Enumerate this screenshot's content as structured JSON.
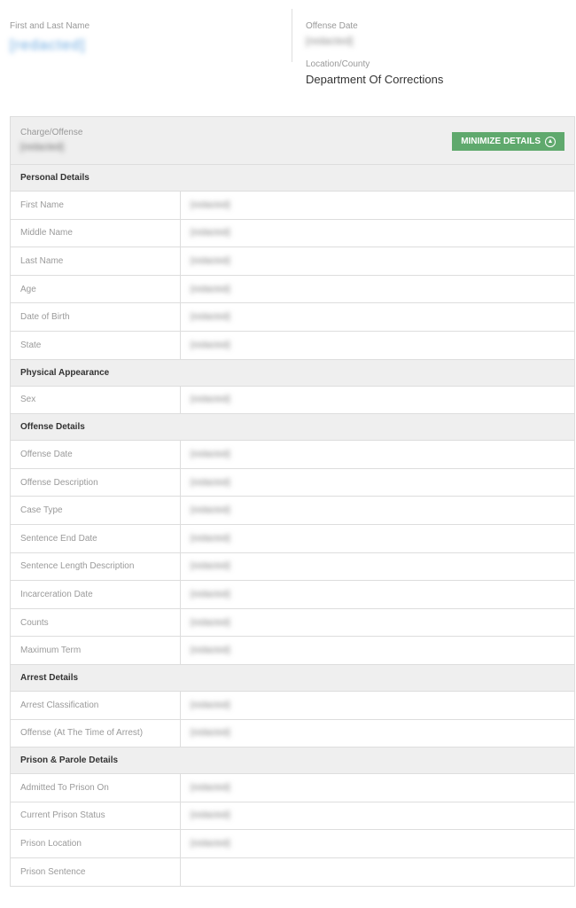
{
  "header": {
    "name_label": "First and Last Name",
    "name_value": "[redacted]",
    "offense_date_label": "Offense Date",
    "offense_date_value": "[redacted]",
    "location_label": "Location/County",
    "location_value": "Department Of Corrections"
  },
  "card": {
    "charge_label": "Charge/Offense",
    "charge_value": "[redacted]",
    "minimize_label": "MINIMIZE DETAILS",
    "minimize_icon": "chevron-up-circle-icon"
  },
  "sections": [
    {
      "title": "Personal Details",
      "rows": [
        {
          "label": "First Name",
          "value": "[redacted]"
        },
        {
          "label": "Middle Name",
          "value": "[redacted]"
        },
        {
          "label": "Last Name",
          "value": "[redacted]"
        },
        {
          "label": "Age",
          "value": "[redacted]"
        },
        {
          "label": "Date of Birth",
          "value": "[redacted]"
        },
        {
          "label": "State",
          "value": "[redacted]"
        }
      ]
    },
    {
      "title": "Physical Appearance",
      "rows": [
        {
          "label": "Sex",
          "value": "[redacted]"
        }
      ]
    },
    {
      "title": "Offense Details",
      "rows": [
        {
          "label": "Offense Date",
          "value": "[redacted]"
        },
        {
          "label": "Offense Description",
          "value": "[redacted]"
        },
        {
          "label": "Case Type",
          "value": "[redacted]"
        },
        {
          "label": "Sentence End Date",
          "value": "[redacted]"
        },
        {
          "label": "Sentence Length Description",
          "value": "[redacted]"
        },
        {
          "label": "Incarceration Date",
          "value": "[redacted]"
        },
        {
          "label": "Counts",
          "value": "[redacted]"
        },
        {
          "label": "Maximum Term",
          "value": "[redacted]"
        }
      ]
    },
    {
      "title": "Arrest Details",
      "rows": [
        {
          "label": "Arrest Classification",
          "value": "[redacted]"
        },
        {
          "label": "Offense (At The Time of Arrest)",
          "value": "[redacted]"
        }
      ]
    },
    {
      "title": "Prison & Parole Details",
      "rows": [
        {
          "label": "Admitted To Prison On",
          "value": "[redacted]"
        },
        {
          "label": "Current Prison Status",
          "value": "[redacted]"
        },
        {
          "label": "Prison Location",
          "value": "[redacted]"
        },
        {
          "label": "Prison Sentence",
          "value": ""
        }
      ]
    }
  ]
}
